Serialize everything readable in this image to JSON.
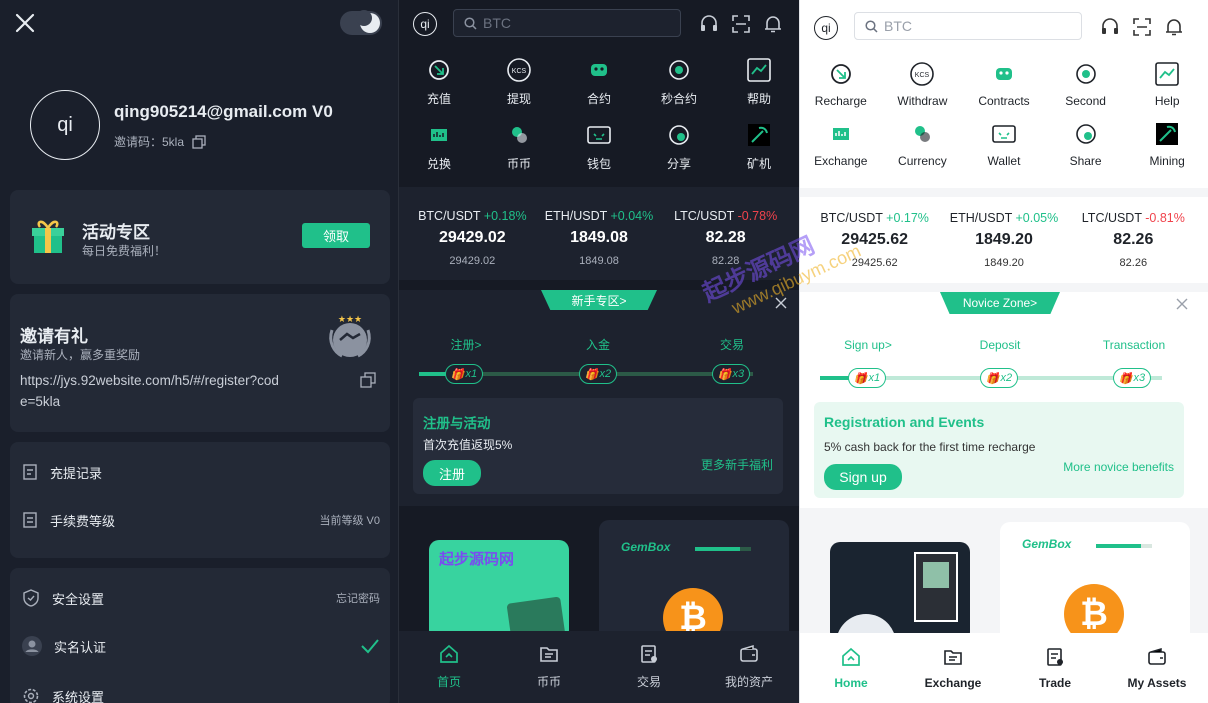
{
  "colors": {
    "accent": "#20c08a",
    "negative": "#f0434c",
    "dark_bg": "#161a24",
    "light_bg": "#ffffff"
  },
  "drawer": {
    "avatar_text": "qi",
    "email": "qing905214@gmail.com V0",
    "invite_code_label": "邀请码：5kla",
    "promo": {
      "title": "活动专区",
      "subtitle": "每日免费福利！",
      "button": "领取"
    },
    "invite": {
      "title": "邀请有礼",
      "subtitle": "邀请新人，赢多重奖励",
      "link": "https://jys.92website.com/h5/#/register?code=5kla"
    },
    "menu1": [
      {
        "label": "充提记录",
        "right": ""
      },
      {
        "label": "手续费等级",
        "right": "当前等级 V0"
      }
    ],
    "menu2": [
      {
        "label": "安全设置",
        "right": "忘记密码"
      },
      {
        "label": "实名认证",
        "right": ""
      },
      {
        "label": "系统设置",
        "right": ""
      }
    ]
  },
  "cn": {
    "search_placeholder": "BTC",
    "logo": "qi",
    "actions": [
      "充值",
      "提现",
      "合约",
      "秒合约",
      "帮助",
      "兑换",
      "币币",
      "钱包",
      "分享",
      "矿机"
    ],
    "tickers": [
      {
        "pair": "BTC/USDT",
        "change": "+0.18%",
        "price": "29429.02",
        "sub": "29429.02",
        "up": true
      },
      {
        "pair": "ETH/USDT",
        "change": "+0.04%",
        "price": "1849.08",
        "sub": "1849.08",
        "up": true
      },
      {
        "pair": "LTC/USDT",
        "change": "-0.78%",
        "price": "82.28",
        "sub": "82.28",
        "up": false
      }
    ],
    "novice_tab": "新手专区>",
    "steps": [
      "注册>",
      "入金",
      "交易"
    ],
    "badges": [
      "x1",
      "x2",
      "x3"
    ],
    "reg_title": "注册与活动",
    "reg_desc": "首次充值返现5%",
    "reg_button": "注册",
    "more_benefits": "更多新手福利",
    "watermark": "起步源码网",
    "gembox": "GemBox",
    "nav": [
      "首页",
      "币币",
      "交易",
      "我的资产"
    ]
  },
  "en": {
    "search_placeholder": "BTC",
    "logo": "qi",
    "actions": [
      "Recharge",
      "Withdraw",
      "Contracts",
      "Second",
      "Help",
      "Exchange",
      "Currency",
      "Wallet",
      "Share",
      "Mining"
    ],
    "tickers": [
      {
        "pair": "BTC/USDT",
        "change": "+0.17%",
        "price": "29425.62",
        "sub": "29425.62",
        "up": true
      },
      {
        "pair": "ETH/USDT",
        "change": "+0.05%",
        "price": "1849.20",
        "sub": "1849.20",
        "up": true
      },
      {
        "pair": "LTC/USDT",
        "change": "-0.81%",
        "price": "82.26",
        "sub": "82.26",
        "up": false
      }
    ],
    "novice_tab": "Novice Zone>",
    "steps": [
      "Sign up>",
      "Deposit",
      "Transaction"
    ],
    "badges": [
      "x1",
      "x2",
      "x3"
    ],
    "reg_title": "Registration and Events",
    "reg_desc": "5% cash back for the first time recharge",
    "reg_button": "Sign up",
    "more_benefits": "More novice benefits",
    "gembox": "GemBox",
    "nav": [
      "Home",
      "Exchange",
      "Trade",
      "My Assets"
    ]
  },
  "watermark": {
    "text": "起步源码网",
    "url": "www.qibuym.com"
  }
}
